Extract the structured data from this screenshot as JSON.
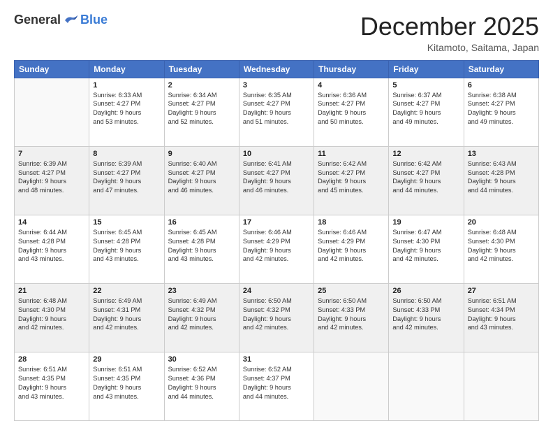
{
  "header": {
    "logo_general": "General",
    "logo_blue": "Blue",
    "title": "December 2025",
    "location": "Kitamoto, Saitama, Japan"
  },
  "weekdays": [
    "Sunday",
    "Monday",
    "Tuesday",
    "Wednesday",
    "Thursday",
    "Friday",
    "Saturday"
  ],
  "weeks": [
    {
      "shade": "white",
      "days": [
        {
          "num": "",
          "info": ""
        },
        {
          "num": "1",
          "info": "Sunrise: 6:33 AM\nSunset: 4:27 PM\nDaylight: 9 hours\nand 53 minutes."
        },
        {
          "num": "2",
          "info": "Sunrise: 6:34 AM\nSunset: 4:27 PM\nDaylight: 9 hours\nand 52 minutes."
        },
        {
          "num": "3",
          "info": "Sunrise: 6:35 AM\nSunset: 4:27 PM\nDaylight: 9 hours\nand 51 minutes."
        },
        {
          "num": "4",
          "info": "Sunrise: 6:36 AM\nSunset: 4:27 PM\nDaylight: 9 hours\nand 50 minutes."
        },
        {
          "num": "5",
          "info": "Sunrise: 6:37 AM\nSunset: 4:27 PM\nDaylight: 9 hours\nand 49 minutes."
        },
        {
          "num": "6",
          "info": "Sunrise: 6:38 AM\nSunset: 4:27 PM\nDaylight: 9 hours\nand 49 minutes."
        }
      ]
    },
    {
      "shade": "shaded",
      "days": [
        {
          "num": "7",
          "info": "Sunrise: 6:39 AM\nSunset: 4:27 PM\nDaylight: 9 hours\nand 48 minutes."
        },
        {
          "num": "8",
          "info": "Sunrise: 6:39 AM\nSunset: 4:27 PM\nDaylight: 9 hours\nand 47 minutes."
        },
        {
          "num": "9",
          "info": "Sunrise: 6:40 AM\nSunset: 4:27 PM\nDaylight: 9 hours\nand 46 minutes."
        },
        {
          "num": "10",
          "info": "Sunrise: 6:41 AM\nSunset: 4:27 PM\nDaylight: 9 hours\nand 46 minutes."
        },
        {
          "num": "11",
          "info": "Sunrise: 6:42 AM\nSunset: 4:27 PM\nDaylight: 9 hours\nand 45 minutes."
        },
        {
          "num": "12",
          "info": "Sunrise: 6:42 AM\nSunset: 4:27 PM\nDaylight: 9 hours\nand 44 minutes."
        },
        {
          "num": "13",
          "info": "Sunrise: 6:43 AM\nSunset: 4:28 PM\nDaylight: 9 hours\nand 44 minutes."
        }
      ]
    },
    {
      "shade": "white",
      "days": [
        {
          "num": "14",
          "info": "Sunrise: 6:44 AM\nSunset: 4:28 PM\nDaylight: 9 hours\nand 43 minutes."
        },
        {
          "num": "15",
          "info": "Sunrise: 6:45 AM\nSunset: 4:28 PM\nDaylight: 9 hours\nand 43 minutes."
        },
        {
          "num": "16",
          "info": "Sunrise: 6:45 AM\nSunset: 4:28 PM\nDaylight: 9 hours\nand 43 minutes."
        },
        {
          "num": "17",
          "info": "Sunrise: 6:46 AM\nSunset: 4:29 PM\nDaylight: 9 hours\nand 42 minutes."
        },
        {
          "num": "18",
          "info": "Sunrise: 6:46 AM\nSunset: 4:29 PM\nDaylight: 9 hours\nand 42 minutes."
        },
        {
          "num": "19",
          "info": "Sunrise: 6:47 AM\nSunset: 4:30 PM\nDaylight: 9 hours\nand 42 minutes."
        },
        {
          "num": "20",
          "info": "Sunrise: 6:48 AM\nSunset: 4:30 PM\nDaylight: 9 hours\nand 42 minutes."
        }
      ]
    },
    {
      "shade": "shaded",
      "days": [
        {
          "num": "21",
          "info": "Sunrise: 6:48 AM\nSunset: 4:30 PM\nDaylight: 9 hours\nand 42 minutes."
        },
        {
          "num": "22",
          "info": "Sunrise: 6:49 AM\nSunset: 4:31 PM\nDaylight: 9 hours\nand 42 minutes."
        },
        {
          "num": "23",
          "info": "Sunrise: 6:49 AM\nSunset: 4:32 PM\nDaylight: 9 hours\nand 42 minutes."
        },
        {
          "num": "24",
          "info": "Sunrise: 6:50 AM\nSunset: 4:32 PM\nDaylight: 9 hours\nand 42 minutes."
        },
        {
          "num": "25",
          "info": "Sunrise: 6:50 AM\nSunset: 4:33 PM\nDaylight: 9 hours\nand 42 minutes."
        },
        {
          "num": "26",
          "info": "Sunrise: 6:50 AM\nSunset: 4:33 PM\nDaylight: 9 hours\nand 42 minutes."
        },
        {
          "num": "27",
          "info": "Sunrise: 6:51 AM\nSunset: 4:34 PM\nDaylight: 9 hours\nand 43 minutes."
        }
      ]
    },
    {
      "shade": "white",
      "days": [
        {
          "num": "28",
          "info": "Sunrise: 6:51 AM\nSunset: 4:35 PM\nDaylight: 9 hours\nand 43 minutes."
        },
        {
          "num": "29",
          "info": "Sunrise: 6:51 AM\nSunset: 4:35 PM\nDaylight: 9 hours\nand 43 minutes."
        },
        {
          "num": "30",
          "info": "Sunrise: 6:52 AM\nSunset: 4:36 PM\nDaylight: 9 hours\nand 44 minutes."
        },
        {
          "num": "31",
          "info": "Sunrise: 6:52 AM\nSunset: 4:37 PM\nDaylight: 9 hours\nand 44 minutes."
        },
        {
          "num": "",
          "info": ""
        },
        {
          "num": "",
          "info": ""
        },
        {
          "num": "",
          "info": ""
        }
      ]
    }
  ]
}
